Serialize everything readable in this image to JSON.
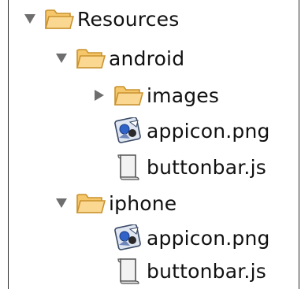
{
  "tree": {
    "root": {
      "label": "Resources",
      "icon": "folder-icon",
      "expanded": true
    },
    "android": {
      "label": "android",
      "icon": "folder-icon",
      "expanded": true,
      "children": {
        "images": {
          "label": "images",
          "icon": "folder-icon",
          "expanded": false
        },
        "appicon": {
          "label": "appicon.png",
          "icon": "image-file-icon"
        },
        "buttonbar": {
          "label": "buttonbar.js",
          "icon": "script-file-icon"
        }
      }
    },
    "iphone": {
      "label": "iphone",
      "icon": "folder-icon",
      "expanded": true,
      "children": {
        "appicon": {
          "label": "appicon.png",
          "icon": "image-file-icon"
        },
        "buttonbar": {
          "label": "buttonbar.js",
          "icon": "script-file-icon"
        }
      }
    }
  },
  "colors": {
    "triangle": "#6e6e6e",
    "folder_fill": "#f6c66a",
    "folder_stroke": "#c9922e",
    "script_fill": "#f2f2f2",
    "script_stroke": "#555555"
  }
}
